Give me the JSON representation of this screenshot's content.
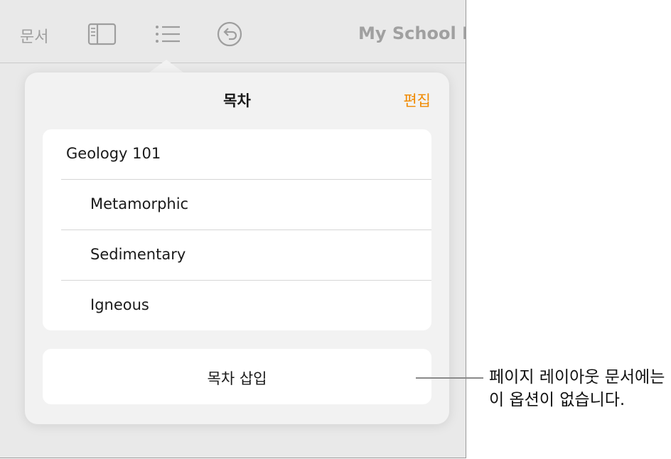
{
  "toolbar": {
    "docs_label": "문서",
    "title": "My School R",
    "icons": [
      "sidebar-icon",
      "list-icon",
      "undo-icon"
    ]
  },
  "popover": {
    "title": "목차",
    "edit_label": "편집",
    "items": [
      {
        "label": "Geology 101",
        "level": 1
      },
      {
        "label": "Metamorphic",
        "level": 2
      },
      {
        "label": "Sedimentary",
        "level": 2
      },
      {
        "label": "Igneous",
        "level": 2
      }
    ],
    "insert_label": "목차 삽입"
  },
  "callout": {
    "line1": "페이지 레이아웃 문서에는",
    "line2": "이 옵션이 없습니다."
  },
  "colors": {
    "accent": "#f08a00",
    "screen_bg": "#e9e9e9",
    "popover_bg": "#f2f2f2"
  }
}
